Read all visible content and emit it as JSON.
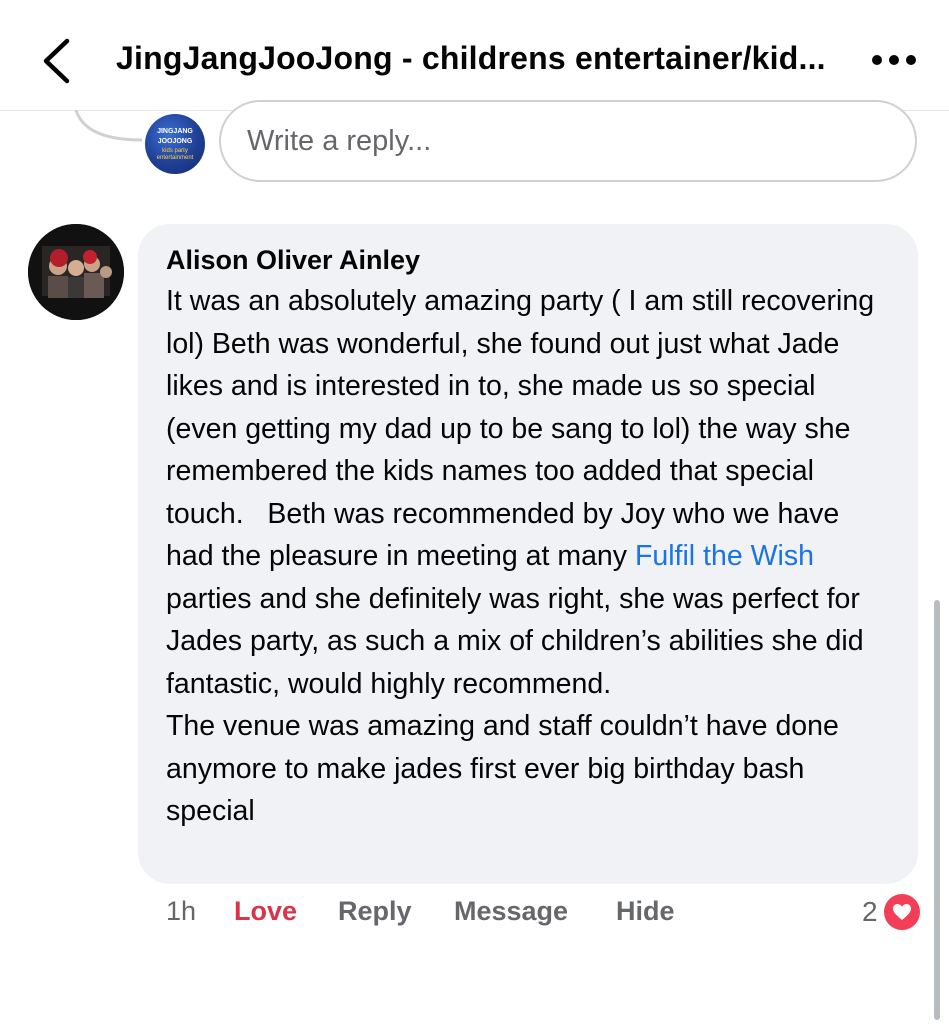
{
  "header": {
    "title": "JingJangJooJong - childrens entertainer/kid...",
    "back_icon": "chevron-left-icon",
    "more_icon": "more-horizontal-icon"
  },
  "reply_composer": {
    "placeholder": "Write a reply...",
    "avatar_logo": "JINGJANG JOOJONG",
    "avatar_sub": "kids party entertainment"
  },
  "comment": {
    "author": "Alison Oliver Ainley",
    "text_before_link": "It was an absolutely amazing party ( I am still recovering lol) Beth was wonderful, she found out just what Jade likes and is interested in to, she made us so special (even getting my dad up to be sang to lol) the way she remembered the kids names too added that special touch.   Beth was recommended by Joy who we have had the pleasure in meeting at many ",
    "link_text": "Fulfil the Wish",
    "text_after_link": " parties and she definitely was right, she was perfect for Jades party, as such a mix of children’s abilities she did fantastic, would highly recommend.\nThe venue was amazing and staff couldn’t have done anymore to make jades first ever big birthday bash special",
    "link_color": "#1b74e4"
  },
  "actions": {
    "time": "1h",
    "love": "Love",
    "reply": "Reply",
    "message": "Message",
    "hide": "Hide",
    "love_color": "#d8344a"
  },
  "reaction": {
    "count": "2",
    "icon": "heart-icon",
    "color": "#f33e58"
  }
}
